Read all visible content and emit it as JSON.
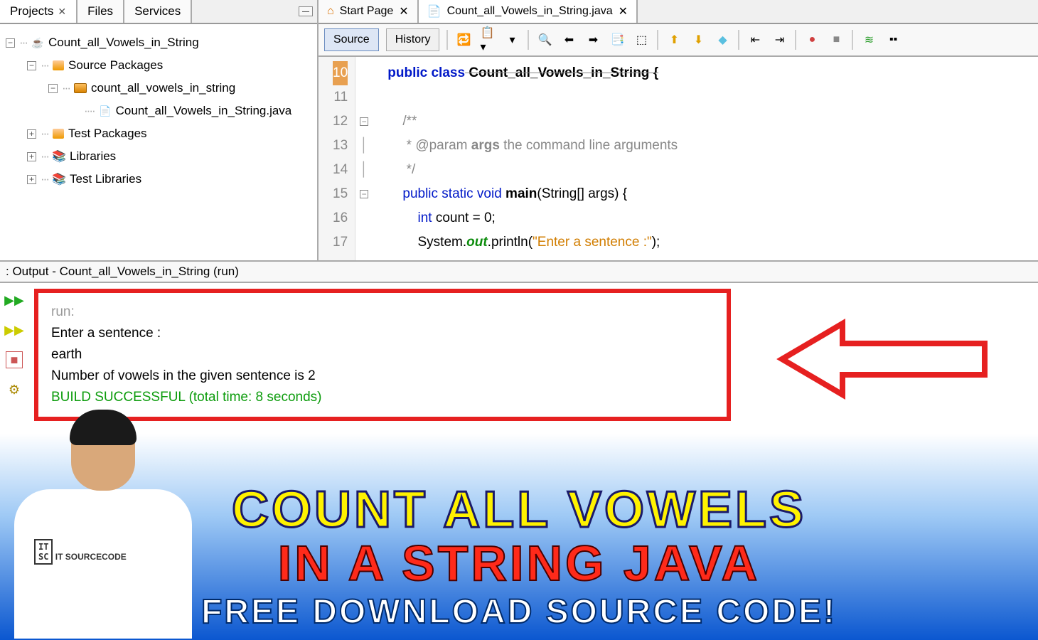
{
  "leftTabs": {
    "projects": "Projects",
    "files": "Files",
    "services": "Services"
  },
  "tree": {
    "root": "Count_all_Vowels_in_String",
    "srcPackages": "Source Packages",
    "package": "count_all_vowels_in_string",
    "file": "Count_all_Vowels_in_String.java",
    "testPackages": "Test Packages",
    "libraries": "Libraries",
    "testLibraries": "Test Libraries"
  },
  "editorTabs": {
    "startPage": "Start Page",
    "file": "Count_all_Vowels_in_String.java"
  },
  "toolbar": {
    "source": "Source",
    "history": "History"
  },
  "code": {
    "lineNumbers": [
      "10",
      "11",
      "12",
      "13",
      "14",
      "15",
      "16",
      "17"
    ],
    "line10_a": "public class",
    "line10_b": " Count_all_Vowels_in_String {",
    "line12": "/**",
    "line13_a": " * @param ",
    "line13_b": "args",
    "line13_c": " the command line arguments",
    "line14": " */",
    "line15_a": "public static void",
    "line15_b": " main",
    "line15_c": "(String[] args) {",
    "line16_a": "int",
    "line16_b": " count = 0;",
    "line17_a": "System.",
    "line17_b": "out",
    "line17_c": ".println(",
    "line17_d": "\"Enter a sentence :\"",
    "line17_e": ");"
  },
  "output": {
    "title": "Output - Count_all_Vowels_in_String (run)",
    "run": "run:",
    "line1": "Enter a sentence :",
    "line2": "earth",
    "line3": "Number of vowels in the given sentence is 2",
    "build": "BUILD SUCCESSFUL (total time: 8 seconds)"
  },
  "banner": {
    "line1": "COUNT ALL VOWELS",
    "line2": "IN A STRING JAVA",
    "line3": "FREE DOWNLOAD SOURCE CODE!"
  },
  "person": {
    "logo": "IT SOURCECODE"
  }
}
